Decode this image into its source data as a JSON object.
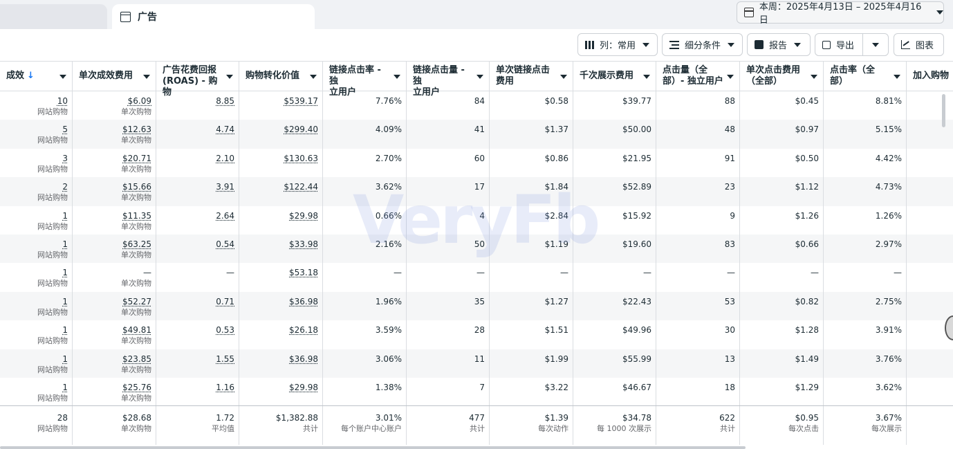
{
  "tabs": {
    "ads_label": "广告"
  },
  "date_range": {
    "label": "本周：2025年4月13日 – 2025年4月16日"
  },
  "toolbar": {
    "columns_label": "列：常用",
    "breakdown_label": "细分条件",
    "report_label": "报告",
    "export_label": "导出",
    "chart_label": "图表"
  },
  "watermark": "VeryFb",
  "colors": {
    "accent": "#1877f2",
    "border": "#dadde1",
    "shade": "#f5f6f7"
  },
  "table": {
    "headers": [
      {
        "l1": "成效",
        "l2": ""
      },
      {
        "l1": "单次成效费用",
        "l2": ""
      },
      {
        "l1": "广告花费回报",
        "l2": "(ROAS) - 购物"
      },
      {
        "l1": "购物转化价值",
        "l2": ""
      },
      {
        "l1": "链接点击率 - 独",
        "l2": "立用户"
      },
      {
        "l1": "链接点击量 - 独",
        "l2": "立用户"
      },
      {
        "l1": "单次链接点击",
        "l2": "费用"
      },
      {
        "l1": "千次展示费用",
        "l2": ""
      },
      {
        "l1": "点击量（全",
        "l2": "部）- 独立用户"
      },
      {
        "l1": "单次点击费用",
        "l2": "（全部）"
      },
      {
        "l1": "点击率（全",
        "l2": "部）"
      },
      {
        "l1": "加入购物",
        "l2": ""
      }
    ],
    "sub_labels": {
      "results": "网站购物",
      "cost": "单次购物"
    },
    "rows": [
      [
        "10",
        "$6.09",
        "8.85",
        "$539.17",
        "7.76%",
        "84",
        "$0.58",
        "$39.77",
        "88",
        "$0.45",
        "8.81%"
      ],
      [
        "5",
        "$12.63",
        "4.74",
        "$299.40",
        "4.09%",
        "41",
        "$1.37",
        "$50.00",
        "48",
        "$0.97",
        "5.15%"
      ],
      [
        "3",
        "$20.71",
        "2.10",
        "$130.63",
        "2.70%",
        "60",
        "$0.86",
        "$21.95",
        "91",
        "$0.50",
        "4.42%"
      ],
      [
        "2",
        "$15.66",
        "3.91",
        "$122.44",
        "3.62%",
        "17",
        "$1.84",
        "$52.89",
        "23",
        "$1.12",
        "4.73%"
      ],
      [
        "1",
        "$11.35",
        "2.64",
        "$29.98",
        "0.66%",
        "4",
        "$2.84",
        "$15.92",
        "9",
        "$1.26",
        "1.26%"
      ],
      [
        "1",
        "$63.25",
        "0.54",
        "$33.98",
        "2.16%",
        "50",
        "$1.19",
        "$19.60",
        "83",
        "$0.66",
        "2.97%"
      ],
      [
        "1",
        "—",
        "—",
        "$53.18",
        "—",
        "—",
        "—",
        "—",
        "—",
        "—",
        "—"
      ],
      [
        "1",
        "$52.27",
        "0.71",
        "$36.98",
        "1.96%",
        "35",
        "$1.27",
        "$22.43",
        "53",
        "$0.82",
        "2.75%"
      ],
      [
        "1",
        "$49.81",
        "0.53",
        "$26.18",
        "3.59%",
        "28",
        "$1.51",
        "$49.96",
        "30",
        "$1.28",
        "3.91%"
      ],
      [
        "1",
        "$23.85",
        "1.55",
        "$36.98",
        "3.06%",
        "11",
        "$1.99",
        "$55.99",
        "13",
        "$1.49",
        "3.76%"
      ],
      [
        "1",
        "$25.76",
        "1.16",
        "$29.98",
        "1.38%",
        "7",
        "$3.22",
        "$46.67",
        "18",
        "$1.29",
        "3.62%"
      ]
    ],
    "shaded_row_index": [
      1,
      3,
      5,
      7,
      9
    ],
    "totals": [
      {
        "v": "28",
        "s": "网站购物"
      },
      {
        "v": "$28.68",
        "s": "单次购物"
      },
      {
        "v": "1.72",
        "s": "平均值"
      },
      {
        "v": "$1,382.88",
        "s": "共计"
      },
      {
        "v": "3.01%",
        "s": "每个账户中心账户"
      },
      {
        "v": "477",
        "s": "共计"
      },
      {
        "v": "$1.39",
        "s": "每次动作"
      },
      {
        "v": "$34.78",
        "s": "每 1000 次展示"
      },
      {
        "v": "622",
        "s": "共计"
      },
      {
        "v": "$0.95",
        "s": "每次点击"
      },
      {
        "v": "3.67%",
        "s": "每次展示"
      }
    ]
  }
}
